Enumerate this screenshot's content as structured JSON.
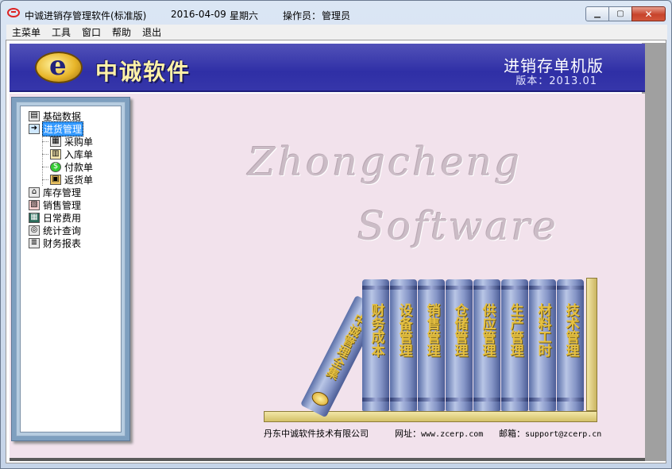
{
  "window": {
    "title": "中诚进销存管理软件(标准版)",
    "date": "2016-04-09",
    "weekday": "星期六",
    "operator_label": "操作员：",
    "operator": "管理员",
    "buttons": {
      "minimize": "▁",
      "maximize": "▢",
      "close": "✕"
    }
  },
  "menu": {
    "items": [
      "主菜单",
      "工具",
      "窗口",
      "帮助",
      "退出"
    ]
  },
  "banner": {
    "brand": "中诚软件",
    "edition": "进销存单机版",
    "version": "版本：2013.01"
  },
  "tree": {
    "items": [
      {
        "label": "基础数据",
        "icon": "database-icon"
      },
      {
        "label": "进货管理",
        "icon": "purchase-icon",
        "selected": true
      },
      {
        "label": "采购单",
        "icon": "order-icon"
      },
      {
        "label": "入库单",
        "icon": "warehouse-in-icon"
      },
      {
        "label": "付款单",
        "icon": "money-bag-icon"
      },
      {
        "label": "返货单",
        "icon": "return-box-icon"
      },
      {
        "label": "库存管理",
        "icon": "bank-icon"
      },
      {
        "label": "销售管理",
        "icon": "sales-icon"
      },
      {
        "label": "日常费用",
        "icon": "calculator-icon"
      },
      {
        "label": "统计查询",
        "icon": "search-doc-icon"
      },
      {
        "label": "财务报表",
        "icon": "report-icon"
      }
    ]
  },
  "watermark": {
    "line1": "Zhongcheng",
    "line2": "Software"
  },
  "books": {
    "leaning": "中诚管理全集",
    "spines": [
      "财务成本",
      "设备管理",
      "销售管理",
      "仓储管理",
      "供应管理",
      "生产管理",
      "材料工时",
      "技术管理"
    ]
  },
  "footer": {
    "company": "丹东中诚软件技术有限公司",
    "web_label": "网址：",
    "web": "www.zcerp.com",
    "mail_label": "邮箱：",
    "mail": "support@zcerp.cn"
  }
}
